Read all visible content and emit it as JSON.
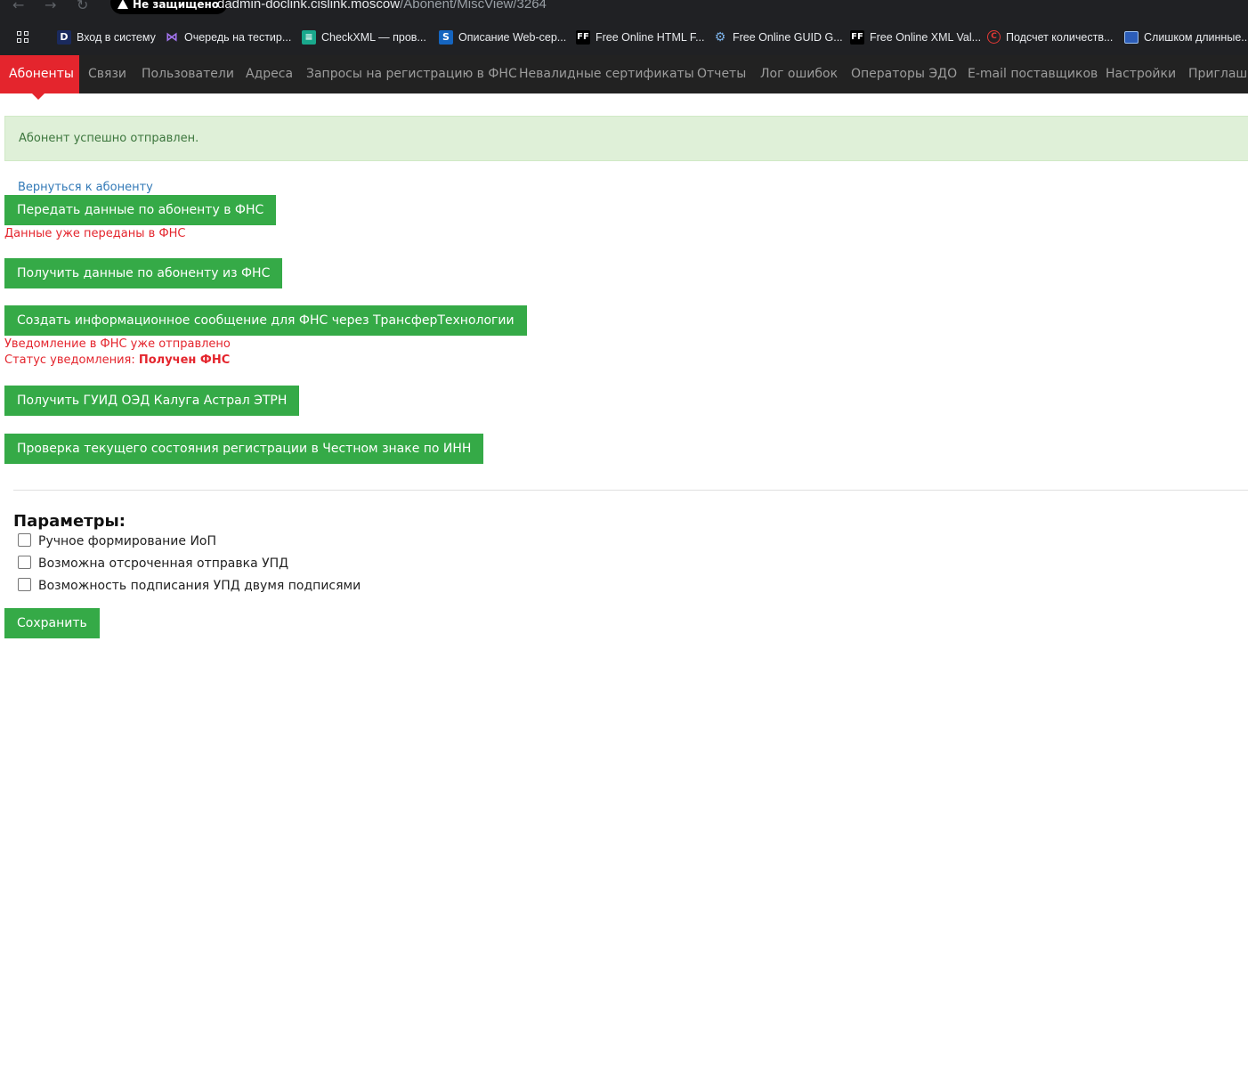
{
  "browser": {
    "security_chip": "Не защищено",
    "url_host": "dadmin-doclink.cislink.moscow",
    "url_path": "/Abonent/MiscView/3264",
    "bookmarks": [
      {
        "label": "Вход в систему",
        "icon": "d-icon"
      },
      {
        "label": "Очередь на тестир...",
        "icon": "visual-studio-icon"
      },
      {
        "label": "CheckXML — пров...",
        "icon": "checkxml-icon"
      },
      {
        "label": "Описание Web-сер...",
        "icon": "sharepoint-icon"
      },
      {
        "label": "Free Online HTML F...",
        "icon": "ff-icon"
      },
      {
        "label": "Free Online GUID G...",
        "icon": "gears-icon"
      },
      {
        "label": "Free Online XML Val...",
        "icon": "ff-icon"
      },
      {
        "label": "Подсчет количеств...",
        "icon": "copyright-icon"
      },
      {
        "label": "Слишком длинные...",
        "icon": "window-icon"
      }
    ]
  },
  "nav": {
    "items": [
      "Абоненты",
      "Связи",
      "Пользователи",
      "Адреса",
      "Запросы на регистрацию в ФНС",
      "Невалидные сертификаты",
      "Отчеты",
      "Лог ошибок",
      "Операторы ЭДО",
      "E-mail поставщиков",
      "Настройки",
      "Приглаше"
    ],
    "active": "Абоненты"
  },
  "alert": {
    "message": "Абонент успешно отправлен."
  },
  "back_link": "Вернуться к абоненту",
  "actions": {
    "send_fns": "Передать данные по абоненту в ФНС",
    "send_fns_note": "Данные уже переданы в ФНС",
    "get_fns": "Получить данные по абоненту из ФНС",
    "create_message": "Создать информационное сообщение для ФНС через ТрансферТехнологии",
    "notify_sent_note": "Уведомление в ФНС уже отправлено",
    "notify_status_label": "Статус уведомления:",
    "notify_status_value": "Получен ФНС",
    "get_guid": "Получить ГУИД ОЭД Калуга Астрал ЭТРН",
    "check_registration": "Проверка текущего состояния регистрации в Честном знаке по ИНН"
  },
  "params": {
    "title": "Параметры:",
    "options": [
      {
        "label": "Ручное формирование ИоП",
        "checked": false
      },
      {
        "label": "Возможна отсроченная отправка УПД",
        "checked": false
      },
      {
        "label": "Возможность подписания УПД двумя подписями",
        "checked": false
      }
    ],
    "save": "Сохранить"
  },
  "colors": {
    "accent_red": "#e4252d",
    "button_green": "#35aa47",
    "alert_bg": "#dff0d8",
    "alert_text": "#3c763d",
    "link_blue": "#337ab7",
    "nav_bg": "#222222"
  }
}
